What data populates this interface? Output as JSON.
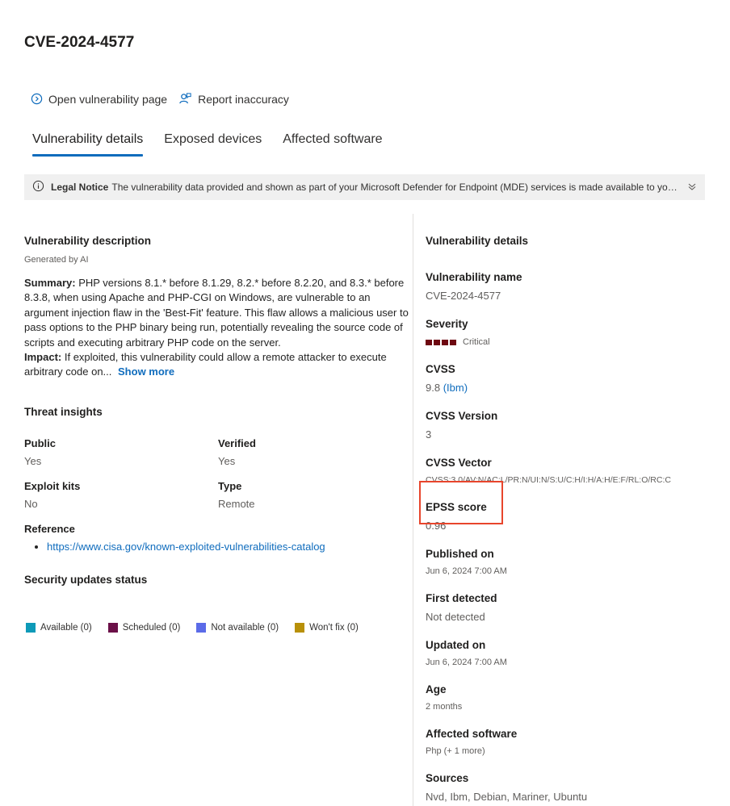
{
  "page_title": "CVE-2024-4577",
  "actions": {
    "open_label": "Open vulnerability page",
    "report_label": "Report inaccuracy"
  },
  "tabs": [
    {
      "label": "Vulnerability details"
    },
    {
      "label": "Exposed devices"
    },
    {
      "label": "Affected software"
    }
  ],
  "notice": {
    "bold": "Legal Notice",
    "text": "The vulnerability data provided and shown as part of your Microsoft Defender for Endpoint (MDE) services is made available to you in it..."
  },
  "description": {
    "title": "Vulnerability description",
    "generated": "Generated by AI",
    "summary_label": "Summary:",
    "summary_text": "PHP versions 8.1.* before 8.1.29, 8.2.* before 8.2.20, and 8.3.* before 8.3.8, when using Apache and PHP-CGI on Windows, are vulnerable to an argument injection flaw in the 'Best-Fit' feature. This flaw allows a malicious user to pass options to the PHP binary being run, potentially revealing the source code of scripts and executing arbitrary PHP code on the server.",
    "impact_label": "Impact:",
    "impact_text": "If exploited, this vulnerability could allow a remote attacker to execute arbitrary code on...",
    "show_more": "Show more"
  },
  "threat_insights": {
    "title": "Threat insights",
    "public_label": "Public",
    "public_value": "Yes",
    "verified_label": "Verified",
    "verified_value": "Yes",
    "exploit_label": "Exploit kits",
    "exploit_value": "No",
    "type_label": "Type",
    "type_value": "Remote",
    "reference_label": "Reference",
    "reference_link": "https://www.cisa.gov/known-exploited-vulnerabilities-catalog"
  },
  "security_updates": {
    "title": "Security updates status",
    "legend": [
      {
        "label": "Available (0)",
        "color": "#0e9ab8"
      },
      {
        "label": "Scheduled (0)",
        "color": "#6b1048"
      },
      {
        "label": "Not available (0)",
        "color": "#5b6be8"
      },
      {
        "label": "Won't fix (0)",
        "color": "#b89008"
      }
    ]
  },
  "details": {
    "title": "Vulnerability details",
    "name_label": "Vulnerability name",
    "name_value": "CVE-2024-4577",
    "severity_label": "Severity",
    "severity_value": "Critical",
    "severity_color": "#6e0811",
    "severity_level": 4,
    "cvss_label": "CVSS",
    "cvss_value": "9.8",
    "cvss_source": "(Ibm)",
    "cvss_version_label": "CVSS Version",
    "cvss_version_value": "3",
    "cvss_vector_label": "CVSS Vector",
    "cvss_vector_value": "CVSS:3.0/AV:N/AC:L/PR:N/UI:N/S:U/C:H/I:H/A:H/E:F/RL:O/RC:C",
    "epss_label": "EPSS score",
    "epss_value": "0.96",
    "published_label": "Published on",
    "published_value": "Jun 6, 2024 7:00 AM",
    "first_detected_label": "First detected",
    "first_detected_value": "Not detected",
    "updated_label": "Updated on",
    "updated_value": "Jun 6, 2024 7:00 AM",
    "age_label": "Age",
    "age_value": "2 months",
    "affected_label": "Affected software",
    "affected_value": "Php (+ 1 more)",
    "sources_label": "Sources",
    "sources_value": "Nvd, Ibm, Debian, Mariner, Ubuntu"
  },
  "colors": {
    "accent": "#0f6cbd",
    "highlight": "#e8452c"
  }
}
